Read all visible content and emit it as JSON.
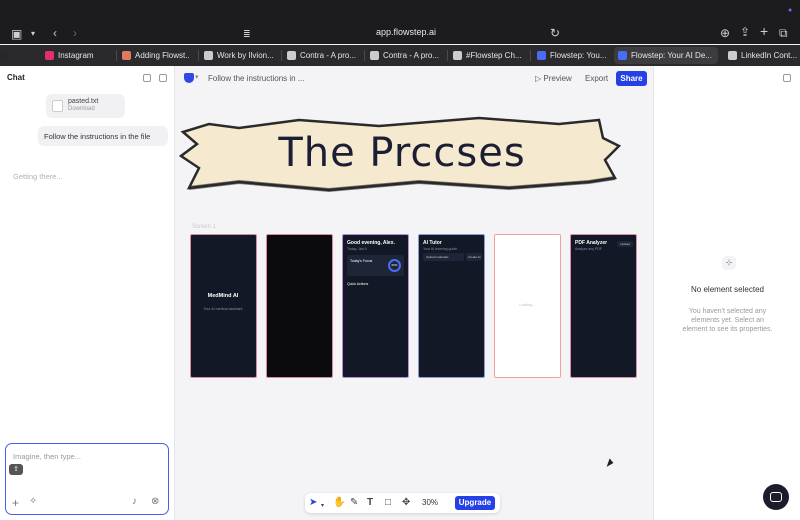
{
  "browser": {
    "url": "app.flowstep.ai",
    "tabs": [
      {
        "label": "Instagram",
        "color": "#e1306c"
      },
      {
        "label": "Adding Flowst...",
        "color": "#e07a5f"
      },
      {
        "label": "Work by Ilvion...",
        "color": "#cccccc"
      },
      {
        "label": "Contra - A pro...",
        "color": "#cccccc"
      },
      {
        "label": "Contra - A pro...",
        "color": "#cccccc"
      },
      {
        "label": "#Flowstep Ch...",
        "color": "#cccccc"
      },
      {
        "label": "Flowstep: You...",
        "color": "#4a6cf7"
      },
      {
        "label": "Flowstep: Your AI De...",
        "color": "#4a6cf7"
      },
      {
        "label": "LinkedIn Cont...",
        "color": "#cccccc"
      }
    ]
  },
  "chat": {
    "title": "Chat",
    "file": {
      "name": "pasted.txt",
      "action": "Download"
    },
    "message": "Follow the instructions in the file",
    "status": "Getting there...",
    "input_placeholder": "Imagine, then type..."
  },
  "canvas": {
    "project_title": "Follow the instructions in ...",
    "preview_label": "Preview",
    "export_label": "Export",
    "share_label": "Share",
    "banner_title": "The Prccses",
    "screen_label": "Screen 1",
    "screens": [
      {
        "title": "MedMind AI",
        "sub": "Your AI medical assistant"
      },
      {
        "title": "",
        "sub": ""
      },
      {
        "title": "Good evening, Alex.",
        "sub": "Today, Jan 5",
        "card": "Today's Focus",
        "card_value": "60%",
        "section": "Quick Actions"
      },
      {
        "title": "AI Tutor",
        "sub": "Your AI learning guide",
        "action_left": "Upload materials",
        "action_right": "Create AI"
      },
      {
        "title": "",
        "sub": "Loading..."
      },
      {
        "title": "PDF Analyzer",
        "sub": "Analyze any PDF",
        "badge": "Upload"
      }
    ],
    "zoom": "30%",
    "upgrade_label": "Upgrade"
  },
  "props": {
    "heading": "No element selected",
    "description": "You haven't selected any elements yet. Select an element to see its properties."
  },
  "colors": {
    "accent": "#2541e5",
    "dark_screen": "#121826"
  }
}
